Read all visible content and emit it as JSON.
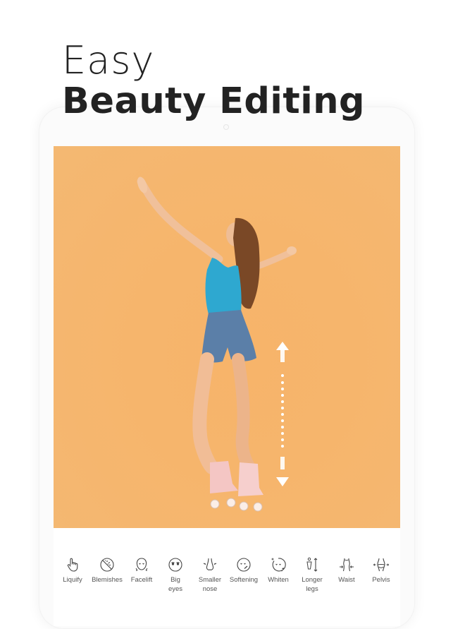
{
  "headline": {
    "line1": "Easy",
    "line2": "Beauty Editing"
  },
  "photo": {
    "subject": "woman on roller skates with arms outstretched",
    "background_color": "#f6b56c",
    "overlay_icon": "vertical-stretch-arrows-icon"
  },
  "toolbar": {
    "tools": [
      {
        "label": "Liquify",
        "icon": "hand-pointer-icon"
      },
      {
        "label": "Blemishes",
        "icon": "blemish-face-icon"
      },
      {
        "label": "Facelift",
        "icon": "facelift-icon"
      },
      {
        "label": "Big\neyes",
        "icon": "big-eyes-icon"
      },
      {
        "label": "Smaller\nnose",
        "icon": "nose-icon"
      },
      {
        "label": "Softening",
        "icon": "softening-face-icon"
      },
      {
        "label": "Whiten",
        "icon": "whiten-face-icon"
      },
      {
        "label": "Longer\nlegs",
        "icon": "longer-legs-icon"
      },
      {
        "label": "Waist",
        "icon": "waist-icon"
      },
      {
        "label": "Pelvis",
        "icon": "pelvis-icon"
      }
    ]
  }
}
